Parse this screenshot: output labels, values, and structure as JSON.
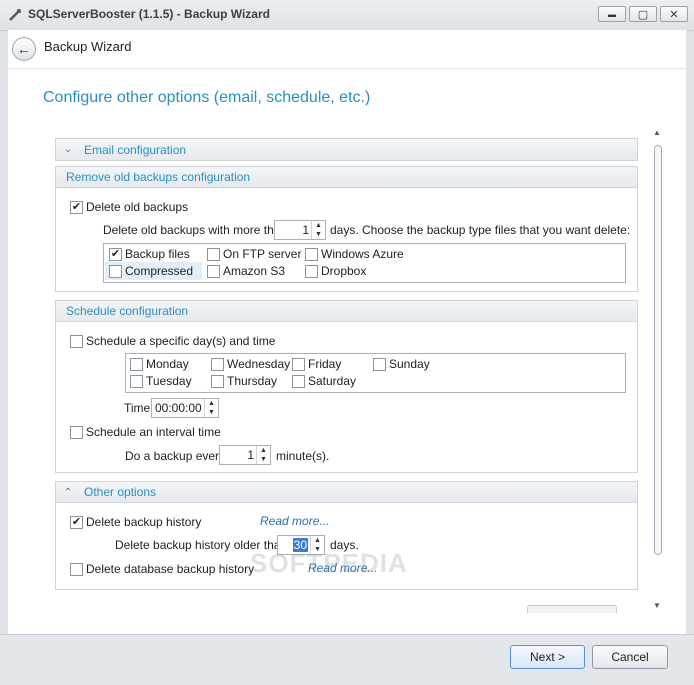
{
  "window": {
    "title": "SQLServerBooster (1.1.5) - Backup Wizard",
    "minimize_glyph": "▬",
    "maximize_glyph": "▢",
    "close_glyph": "✕"
  },
  "header": {
    "title": "Backup Wizard",
    "back_glyph": "←"
  },
  "page_heading": "Configure other options (email, schedule, etc.)",
  "email": {
    "title": "Email configuration",
    "chevron": "⌄"
  },
  "remove_old": {
    "title": "Remove old backups configuration",
    "delete_old_label": "Delete old backups",
    "delete_old_checked": true,
    "more_than_label": "Delete old backups with more than",
    "more_than_value": "1",
    "days_label": "days. Choose the backup type files that you want delete:",
    "types": [
      {
        "label": "Backup files",
        "checked": true
      },
      {
        "label": "On FTP server",
        "checked": false
      },
      {
        "label": "Windows Azure",
        "checked": false
      },
      {
        "label": "Compressed",
        "checked": false
      },
      {
        "label": "Amazon S3",
        "checked": false
      },
      {
        "label": "Dropbox",
        "checked": false
      }
    ]
  },
  "schedule": {
    "title": "Schedule configuration",
    "specific_label": "Schedule a specific day(s) and time",
    "days": [
      "Monday",
      "Wednesday",
      "Friday",
      "Sunday",
      "Tuesday",
      "Thursday",
      "Saturday"
    ],
    "time_label": "Time",
    "time_value": "00:00:00",
    "interval_label": "Schedule an interval time",
    "every_label": "Do a backup every",
    "every_value": "1",
    "minutes_label": "minute(s)."
  },
  "other": {
    "title": "Other options",
    "chevron": "⌃",
    "history_label": "Delete backup history",
    "history_checked": true,
    "read_more_1": "Read more...",
    "older_than_label": "Delete backup history older than",
    "older_than_value": "30",
    "days_label": "days.",
    "db_history_label": "Delete database backup history",
    "read_more_2": "Read more..."
  },
  "scroll": {
    "up": "▲",
    "down": "▼"
  },
  "watermark": "SOFTPEDIA",
  "footer": {
    "next_label": "Next >",
    "cancel_label": "Cancel"
  },
  "check_glyph": "✔",
  "spin_up": "▲",
  "spin_down": "▼"
}
